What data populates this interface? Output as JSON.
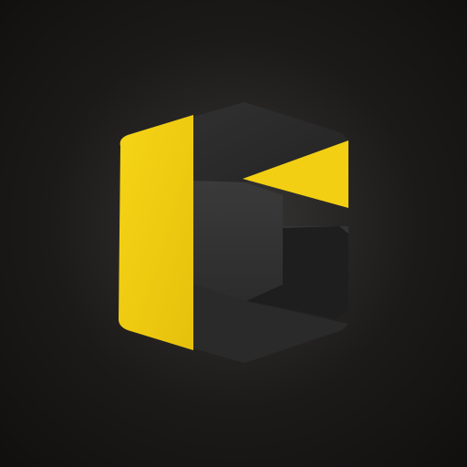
{
  "logo": {
    "icon": "letter-g-logo-icon",
    "colors": {
      "accent": "#f2cf12",
      "accent_shade": "#e2be0a",
      "dark_face": "#2f2f2f",
      "dark_face_light": "#383838",
      "dark_face_shadow": "#1f1f1f",
      "background": "#1a1817"
    }
  }
}
